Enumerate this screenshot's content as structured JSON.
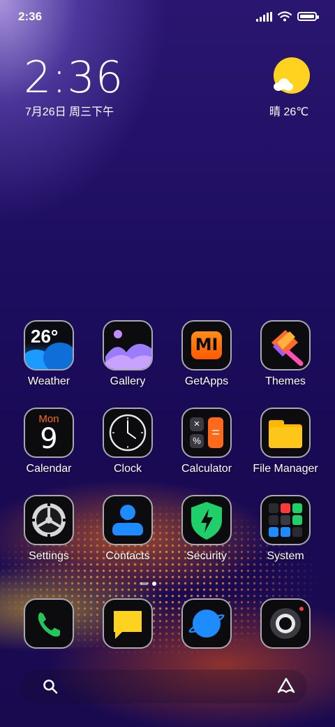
{
  "status_bar": {
    "time": "2:36"
  },
  "lock_widget": {
    "clock": "2:36",
    "date": "7月26日 周三下午",
    "weather": "晴 26℃"
  },
  "apps": [
    {
      "label": "Weather",
      "icon": "weather-icon",
      "badge_text": "26°"
    },
    {
      "label": "Gallery",
      "icon": "gallery-icon"
    },
    {
      "label": "GetApps",
      "icon": "getapps-icon",
      "logo_text": "MI"
    },
    {
      "label": "Themes",
      "icon": "themes-icon"
    },
    {
      "label": "Calendar",
      "icon": "calendar-icon",
      "day_text": "Mon",
      "date_text": "9"
    },
    {
      "label": "Clock",
      "icon": "clock-icon"
    },
    {
      "label": "Calculator",
      "icon": "calculator-icon"
    },
    {
      "label": "File Manager",
      "icon": "folder-icon"
    },
    {
      "label": "Settings",
      "icon": "gear-icon"
    },
    {
      "label": "Contacts",
      "icon": "contacts-icon"
    },
    {
      "label": "Security",
      "icon": "shield-icon"
    },
    {
      "label": "System",
      "icon": "system-folder-icon"
    }
  ],
  "dock": [
    {
      "icon": "phone-icon"
    },
    {
      "icon": "messages-icon"
    },
    {
      "icon": "browser-icon"
    },
    {
      "icon": "camera-icon"
    }
  ],
  "colors": {
    "accent_orange": "#ff6a1a",
    "sun_yellow": "#ffd21f",
    "phone_green": "#22c75a",
    "messages_yellow": "#ffd21f",
    "browser_blue": "#1e8cff",
    "security_green": "#1fcf6a"
  }
}
